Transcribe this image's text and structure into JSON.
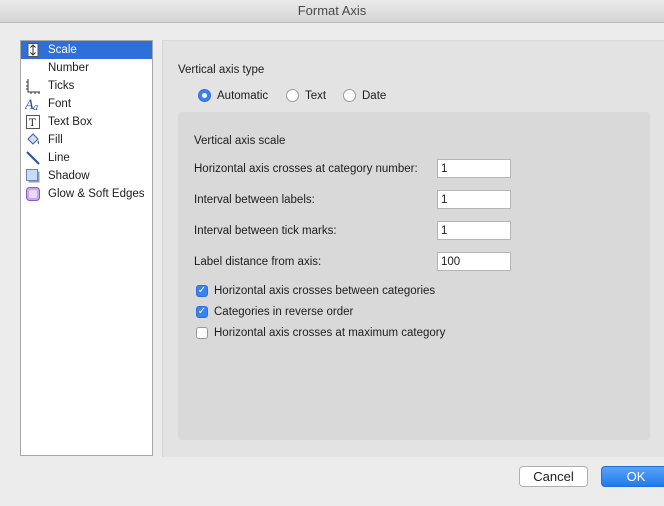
{
  "window": {
    "title": "Format Axis"
  },
  "sidebar": {
    "items": [
      {
        "label": "Scale",
        "icon": "scale-icon",
        "selected": true
      },
      {
        "label": "Number",
        "icon": "none"
      },
      {
        "label": "Ticks",
        "icon": "ticks-icon"
      },
      {
        "label": "Font",
        "icon": "font-icon"
      },
      {
        "label": "Text Box",
        "icon": "text-box-icon"
      },
      {
        "label": "Fill",
        "icon": "fill-bucket-icon"
      },
      {
        "label": "Line",
        "icon": "line-icon"
      },
      {
        "label": "Shadow",
        "icon": "shadow-icon"
      },
      {
        "label": "Glow & Soft Edges",
        "icon": "glow-icon"
      }
    ]
  },
  "axis_type": {
    "label": "Vertical axis type",
    "options": [
      {
        "label": "Automatic",
        "selected": true
      },
      {
        "label": "Text",
        "selected": false
      },
      {
        "label": "Date",
        "selected": false
      }
    ]
  },
  "scale": {
    "title": "Vertical axis scale",
    "fields": [
      {
        "label": "Horizontal axis crosses at category number:",
        "value": "1"
      },
      {
        "label": "Interval between labels:",
        "value": "1"
      },
      {
        "label": "Interval between tick marks:",
        "value": "1"
      },
      {
        "label": "Label distance from axis:",
        "value": "100"
      }
    ],
    "checkboxes": [
      {
        "label": "Horizontal axis crosses between categories",
        "checked": true
      },
      {
        "label": "Categories in reverse order",
        "checked": true
      },
      {
        "label": "Horizontal axis crosses at maximum category",
        "checked": false
      }
    ]
  },
  "buttons": {
    "cancel": "Cancel",
    "ok": "OK"
  },
  "colors": {
    "accent": "#2f6fd8",
    "ok_button": "#1f7bf1"
  }
}
